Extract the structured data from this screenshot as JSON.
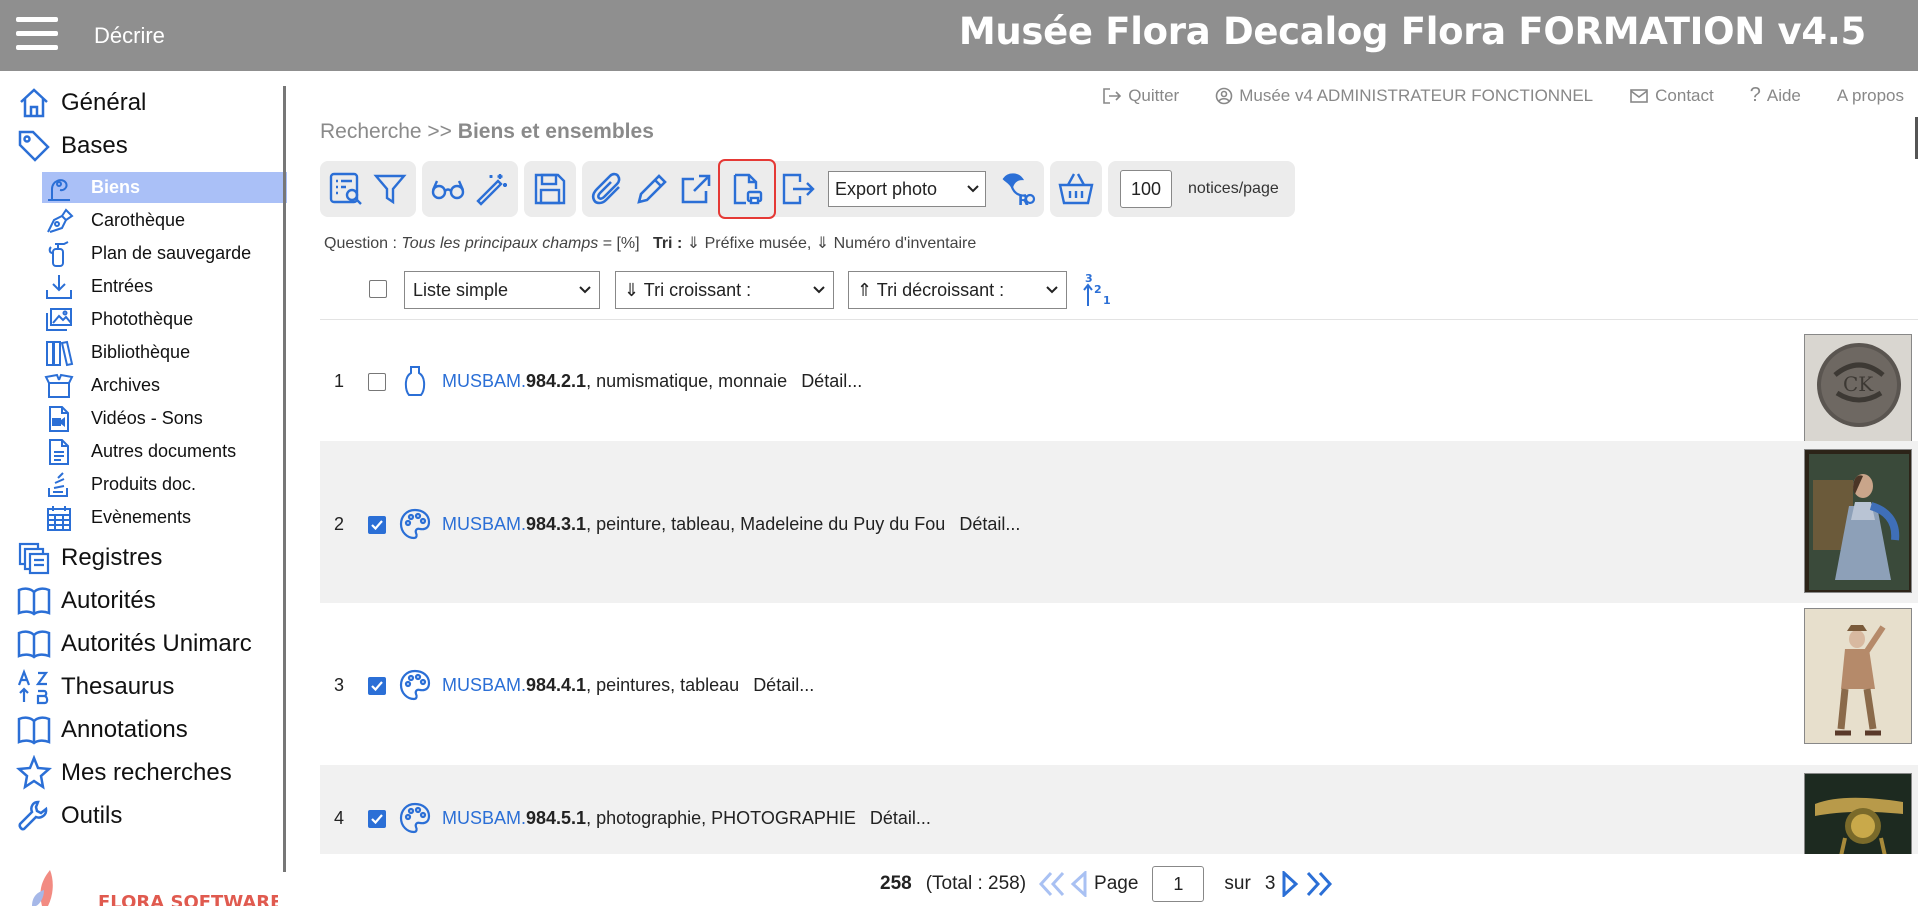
{
  "header": {
    "menu_icon": "hamburger-icon",
    "module": "Décrire",
    "title": "Musée Flora Decalog Flora FORMATION v4.5"
  },
  "toplinks": [
    {
      "icon": "logout-icon",
      "label": "Quitter"
    },
    {
      "icon": "user-circle-icon",
      "label": "Musée v4 ADMINISTRATEUR FONCTIONNEL"
    },
    {
      "icon": "mail-icon",
      "label": "Contact"
    },
    {
      "icon": "question-icon",
      "label": "Aide"
    },
    {
      "icon": "",
      "label": "A propos"
    }
  ],
  "breadcrumb": {
    "root": "Recherche",
    "sep": ">>",
    "current": "Biens et ensembles"
  },
  "sidebar": {
    "top": [
      {
        "label": "Général",
        "icon": "home-icon"
      },
      {
        "label": "Bases",
        "icon": "tag-icon"
      }
    ],
    "bases": [
      {
        "label": "Biens",
        "icon": "statue-icon",
        "active": true
      },
      {
        "label": "Carothèque",
        "icon": "pen-tool-icon"
      },
      {
        "label": "Plan de sauvegarde",
        "icon": "fire-extinguisher-icon"
      },
      {
        "label": "Entrées",
        "icon": "download-icon"
      },
      {
        "label": "Photothèque",
        "icon": "images-icon"
      },
      {
        "label": "Bibliothèque",
        "icon": "books-icon"
      },
      {
        "label": "Archives",
        "icon": "open-box-icon"
      },
      {
        "label": "Vidéos - Sons",
        "icon": "video-file-icon"
      },
      {
        "label": "Autres documents",
        "icon": "document-icon"
      },
      {
        "label": "Produits doc.",
        "icon": "stack-icon"
      },
      {
        "label": "Evènements",
        "icon": "calendar-icon"
      }
    ],
    "bottom": [
      {
        "label": "Registres",
        "icon": "registers-icon"
      },
      {
        "label": "Autorités",
        "icon": "open-book-icon"
      },
      {
        "label": "Autorités Unimarc",
        "icon": "open-book-icon"
      },
      {
        "label": "Thesaurus",
        "icon": "az-sort-icon"
      },
      {
        "label": "Annotations",
        "icon": "open-book-icon"
      },
      {
        "label": "Mes recherches",
        "icon": "star-icon"
      },
      {
        "label": "Outils",
        "icon": "wrench-icon"
      }
    ],
    "logo_text": "FLORA SOFTWARE"
  },
  "toolbar": {
    "export_select": "Export photo",
    "per_page": "100",
    "per_page_label": "notices/page"
  },
  "question": {
    "label": "Question :",
    "query": "Tous les principaux champs",
    "eq": "= [%]",
    "tri_label": "Tri :",
    "tri_value": "⇓ Préfixe musée, ⇓ Numéro d'inventaire"
  },
  "listbar": {
    "display_mode": "Liste simple",
    "sort_asc": "⇓ Tri croissant :",
    "sort_desc": "⇑ Tri décroissant :"
  },
  "rows": [
    {
      "num": "1",
      "checked": false,
      "icon": "vase-icon",
      "prefix": "MUSBAM.",
      "inv": "984.2.1",
      "desc": ", numismatique, monnaie",
      "detail": "Détail..."
    },
    {
      "num": "2",
      "checked": true,
      "icon": "palette-icon",
      "prefix": "MUSBAM.",
      "inv": "984.3.1",
      "desc": ", peinture, tableau, Madeleine du Puy du Fou",
      "detail": "Détail..."
    },
    {
      "num": "3",
      "checked": true,
      "icon": "palette-icon",
      "prefix": "MUSBAM.",
      "inv": "984.4.1",
      "desc": ", peintures, tableau",
      "detail": "Détail..."
    },
    {
      "num": "4",
      "checked": true,
      "icon": "palette-icon",
      "prefix": "MUSBAM.",
      "inv": "984.5.1",
      "desc": ", photographie, PHOTOGRAPHIE",
      "detail": "Détail..."
    }
  ],
  "pager": {
    "count": "258",
    "total": "(Total : 258)",
    "page_label": "Page",
    "page": "1",
    "of_label": "sur",
    "pages": "3"
  },
  "colors": {
    "accent": "#2b6fd6",
    "header": "#8f8f8f",
    "active": "#aac0f7"
  }
}
